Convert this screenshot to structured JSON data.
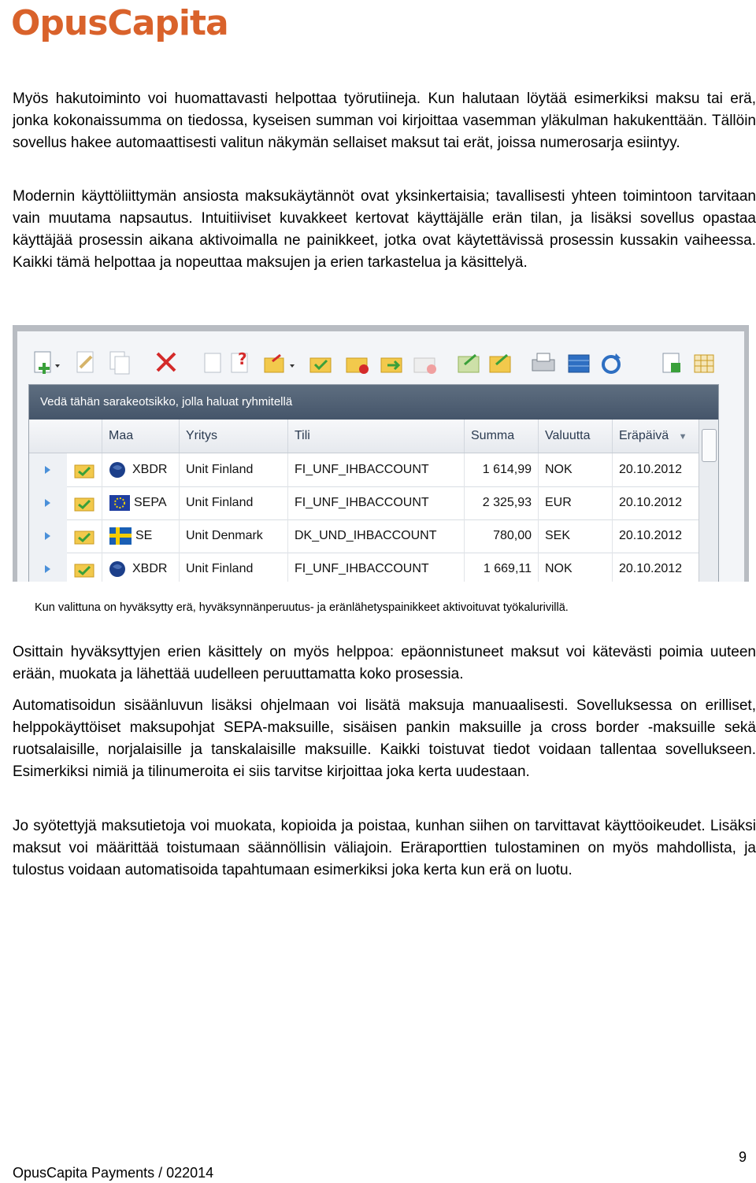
{
  "brand": {
    "logo_text": "OpusCapita"
  },
  "paragraphs": [
    "Myös hakutoiminto voi huomattavasti helpottaa työrutiineja. Kun halutaan löytää esimerkiksi maksu tai erä, jonka kokonaissumma on tiedossa, kyseisen summan voi kirjoittaa vasemman yläkulman hakukenttään. Tällöin sovellus hakee automaattisesti valitun näkymän sellaiset maksut tai erät, joissa numerosarja esiintyy.",
    "Modernin käyttöliittymän ansiosta maksukäytännöt ovat yksinkertaisia; tavallisesti yhteen toimintoon tarvitaan vain muutama napsautus. Intuitiiviset kuvakkeet kertovat käyttäjälle erän tilan, ja lisäksi sovellus opastaa käyttäjää prosessin aikana aktivoimalla ne painikkeet, jotka ovat käytettävissä prosessin kussakin vaiheessa. Kaikki tämä helpottaa ja nopeuttaa maksujen ja erien tarkastelua ja käsittelyä.",
    "Osittain hyväksyttyjen erien käsittely on myös helppoa: epäonnistuneet maksut voi kätevästi poimia uuteen erään, muokata ja lähettää uudelleen peruuttamatta koko prosessia.",
    "Automatisoidun sisäänluvun lisäksi ohjelmaan voi lisätä maksuja manuaalisesti. Sovelluksessa on erilliset, helppokäyttöiset maksupohjat SEPA-maksuille, sisäisen pankin maksuille ja cross border -maksuille sekä ruotsalaisille, norjalaisille ja tanskalaisille maksuille. Kaikki toistuvat tiedot voidaan tallentaa sovellukseen. Esimerkiksi nimiä ja tilinumeroita ei siis tarvitse kirjoittaa joka kerta uudestaan.",
    "Jo syötettyjä maksutietoja voi muokata, kopioida ja poistaa, kunhan siihen on tarvittavat käyttöoikeudet. Lisäksi maksut voi määrittää toistumaan säännöllisin väliajoin. Eräraporttien tulostaminen on myös mahdollista, ja tulostus voidaan automatisoida tapahtumaan esimerkiksi joka kerta kun erä on luotu."
  ],
  "screenshot": {
    "group_hint": "Vedä tähän sarakeotsikko, jolla haluat ryhmitellä",
    "columns": [
      "Maa",
      "Yritys",
      "Tili",
      "Summa",
      "Valuutta",
      "Eräpäivä"
    ],
    "rows": [
      {
        "country": "XBDR",
        "flag": "globe-icon",
        "company": "Unit Finland",
        "account": "FI_UNF_IHBACCOUNT",
        "amount": "1 614,99",
        "currency": "NOK",
        "due": "20.10.2012"
      },
      {
        "country": "SEPA",
        "flag": "eu-flag-icon",
        "company": "Unit Finland",
        "account": "FI_UNF_IHBACCOUNT",
        "amount": "2 325,93",
        "currency": "EUR",
        "due": "20.10.2012"
      },
      {
        "country": "SE",
        "flag": "sweden-flag-icon",
        "company": "Unit Denmark",
        "account": "DK_UND_IHBACCOUNT",
        "amount": "780,00",
        "currency": "SEK",
        "due": "20.10.2012"
      },
      {
        "country": "XBDR",
        "flag": "globe-icon",
        "company": "Unit Finland",
        "account": "FI_UNF_IHBACCOUNT",
        "amount": "1 669,11",
        "currency": "NOK",
        "due": "20.10.2012"
      }
    ]
  },
  "caption": "Kun valittuna on hyväksytty erä, hyväksynnänperuutus- ja eränlähetyspainikkeet aktivoituvat työkalurivillä.",
  "footer": {
    "left": "OpusCapita Payments / 022014",
    "page": "9"
  },
  "colors": {
    "brand": "#d9622b",
    "grid_header": "#4e5e72"
  }
}
